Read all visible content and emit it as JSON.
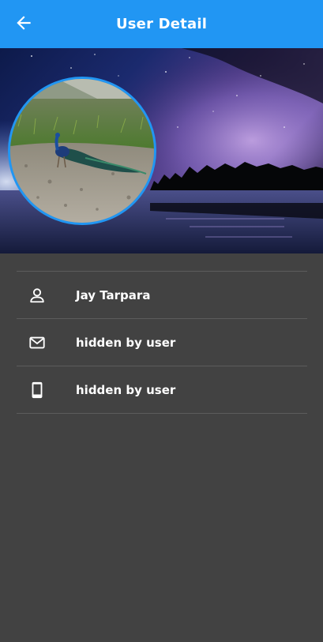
{
  "app_bar": {
    "title": "User Detail",
    "back_icon": "arrow-back-icon",
    "color": "#2196F3"
  },
  "profile": {
    "banner_image": "night-sky-lake-image",
    "avatar_image": "peacock-photo",
    "avatar_border_color": "#2196F3"
  },
  "details": [
    {
      "icon": "person-icon",
      "label": "Jay Tarpara"
    },
    {
      "icon": "mail-icon",
      "label": "hidden by user"
    },
    {
      "icon": "phone-icon",
      "label": "hidden by user"
    }
  ],
  "colors": {
    "background": "#424242",
    "text": "#FFFFFF",
    "divider": "#5C5C5C"
  }
}
